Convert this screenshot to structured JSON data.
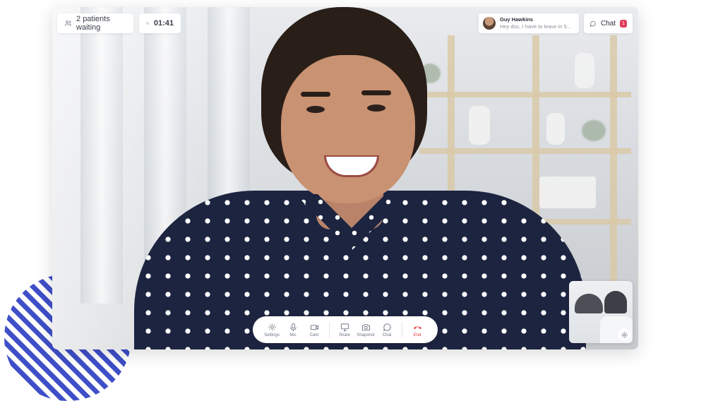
{
  "status": {
    "patients_waiting": "2 patients waiting",
    "timer": "01:41"
  },
  "message": {
    "sender": "Guy Hawkins",
    "preview": "Hey doc, I have to leave in 5..."
  },
  "chat": {
    "label": "Chat",
    "unread_count": "1"
  },
  "controls": [
    {
      "label": "Settings",
      "icon": "gear-icon"
    },
    {
      "label": "Mic",
      "icon": "microphone-icon"
    },
    {
      "label": "Cam",
      "icon": "camera-video-icon"
    },
    {
      "label": "Share",
      "icon": "monitor-share-icon"
    },
    {
      "label": "Snapshot",
      "icon": "snapshot-camera-icon"
    },
    {
      "label": "Chat",
      "icon": "chat-bubble-icon"
    },
    {
      "label": "End",
      "icon": "end-call-icon"
    }
  ],
  "colors": {
    "accent_stripes": "#3f4fc8",
    "end_call": "#e23b3b",
    "chat_badge": "#e23b5b"
  }
}
